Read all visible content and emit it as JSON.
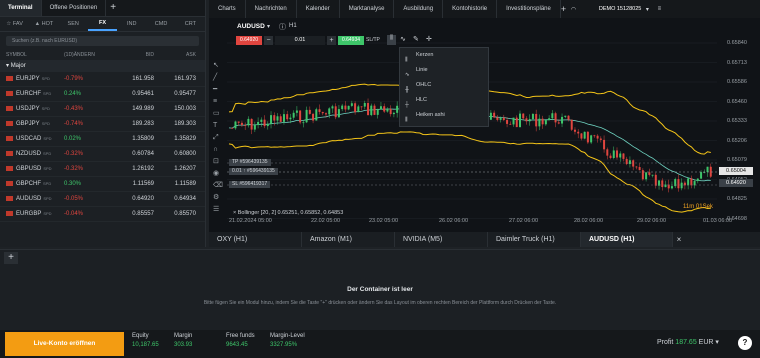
{
  "terminal": {
    "tab_terminal": "Terminal",
    "tab_positions": "Offene Positionen",
    "add": "+",
    "subtabs": [
      "FAV",
      "HOT",
      "SEN",
      "FX",
      "IND",
      "CMD",
      "CRT"
    ],
    "search_placeholder": "Suchen (z.B. nach EURUSD)",
    "columns": [
      "SYMBOL",
      "(1D)ÄNDERN",
      "BID",
      "ASK"
    ],
    "group": "Major",
    "rows": [
      {
        "symbol": "EURJPY",
        "sub": "SPD",
        "change": "-0.79%",
        "bid": "161.958",
        "ask": "161.973",
        "neg": true
      },
      {
        "symbol": "EURCHF",
        "sub": "SPD",
        "change": "0.24%",
        "bid": "0.95461",
        "ask": "0.95477",
        "neg": false
      },
      {
        "symbol": "USDJPY",
        "sub": "SPD",
        "change": "-0.43%",
        "bid": "149.989",
        "ask": "150.003",
        "neg": true
      },
      {
        "symbol": "GBPJPY",
        "sub": "SPD",
        "change": "-0.74%",
        "bid": "189.283",
        "ask": "189.303",
        "neg": true
      },
      {
        "symbol": "USDCAD",
        "sub": "SPD",
        "change": "0.02%",
        "bid": "1.35809",
        "ask": "1.35829",
        "neg": false
      },
      {
        "symbol": "NZDUSD",
        "sub": "SPD",
        "change": "-0.32%",
        "bid": "0.60784",
        "ask": "0.60800",
        "neg": true
      },
      {
        "symbol": "GBPUSD",
        "sub": "SPD",
        "change": "-0.32%",
        "bid": "1.26192",
        "ask": "1.26207",
        "neg": true
      },
      {
        "symbol": "GBPCHF",
        "sub": "SPD",
        "change": "0.30%",
        "bid": "1.11569",
        "ask": "1.11589",
        "neg": false
      },
      {
        "symbol": "AUDUSD",
        "sub": "SPD",
        "change": "-0.05%",
        "bid": "0.64920",
        "ask": "0.64934",
        "neg": true
      },
      {
        "symbol": "EURGBP",
        "sub": "SPD",
        "change": "-0.04%",
        "bid": "0.85557",
        "ask": "0.85570",
        "neg": true
      }
    ]
  },
  "chart": {
    "menu": [
      "Charts",
      "Nachrichten",
      "Kalender",
      "Marktanalyse",
      "Ausbildung",
      "Kontohistorie",
      "Investitionspläne"
    ],
    "account": "DEMO 15128025",
    "symbol": "AUDUSD",
    "timeframe": "H1",
    "sell_price": "0.64920",
    "volume": "0.01",
    "buy_price": "0.64934",
    "sltp": "SL/TP",
    "price_labels": [
      "0.65840",
      "0.65713",
      "0.65586",
      "0.65460",
      "0.65333",
      "0.65206",
      "0.65079",
      "0.64952",
      "0.64825",
      "0.64698"
    ],
    "time_labels": [
      "21.02.2024 05:00",
      "22.02 05:00",
      "23.02 05:00",
      "26.02 06:00",
      "27.02 06:00",
      "28.02 06:00",
      "29.02 06:00",
      "01.03 06:00"
    ],
    "indicator": "Bollinger [20, 2] 0.65251, 0.65852, 0.64853",
    "countdown": "11m 01Sek",
    "current_price_tag": "0.65004",
    "bid_tag": "0.64920",
    "tp_label": "TP",
    "tp_value": "#596439135",
    "sl_label": "SL",
    "sl_value": "#596419317",
    "entry_label": "0.01 ↑",
    "entry_value": "#596439135",
    "chart_types": [
      "Kerzen",
      "Linie",
      "OHLC",
      "HLC",
      "Heiken ashi"
    ],
    "tabs": [
      "OXY (H1)",
      "Amazon (M1)",
      "NVIDIA (M5)",
      "Daimler Truck (H1)",
      "AUDUSD (H1)"
    ]
  },
  "container": {
    "add": "+",
    "title": "Der Container ist leer",
    "hint": "Bitte fügen Sie ein Modul hinzu, indem Sie die Taste \"+\" drücken oder ändern Sie das Layout im oberen rechten Bereich der Plattform durch Drücken der Taste."
  },
  "bottom": {
    "open_account": "Live-Konto eröffnen",
    "equity_label": "Equity",
    "equity_value": "10,187.65",
    "margin_label": "Margin",
    "margin_value": "303.93",
    "free_label": "Free funds",
    "free_value": "9643.45",
    "margin_level_label": "Margin-Level",
    "margin_level_value": "3327.95%",
    "profit_label": "Profit",
    "profit_value": "187.65",
    "currency": "EUR",
    "help": "?"
  },
  "colors": {
    "accent": "#f39c12",
    "buy": "#3ec66a",
    "sell": "#e0453f",
    "bollinger": "#f5c518",
    "ma": "#6fd3c1"
  }
}
